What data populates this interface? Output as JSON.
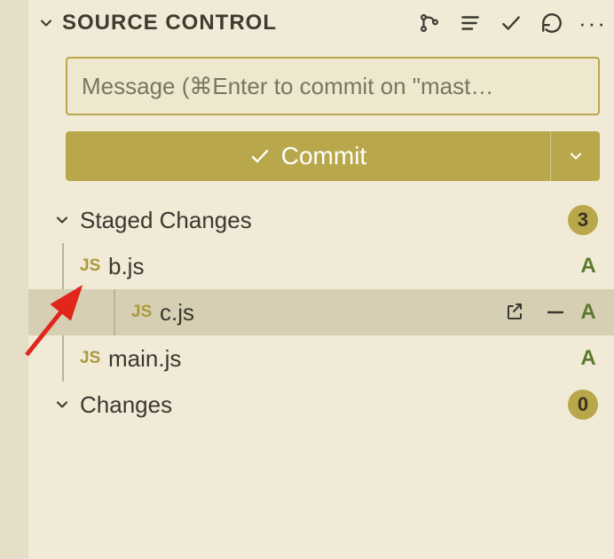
{
  "header": {
    "title": "SOURCE CONTROL"
  },
  "commit": {
    "placeholder": "Message (⌘Enter to commit on \"mast…",
    "button_label": "Commit"
  },
  "sections": {
    "staged": {
      "label": "Staged Changes",
      "count": "3"
    },
    "changes": {
      "label": "Changes",
      "count": "0"
    }
  },
  "files": [
    {
      "icon": "JS",
      "name": "b.js",
      "status": "A",
      "selected": false,
      "show_actions": false
    },
    {
      "icon": "JS",
      "name": "c.js",
      "status": "A",
      "selected": true,
      "show_actions": true
    },
    {
      "icon": "JS",
      "name": "main.js",
      "status": "A",
      "selected": false,
      "show_actions": false
    }
  ]
}
